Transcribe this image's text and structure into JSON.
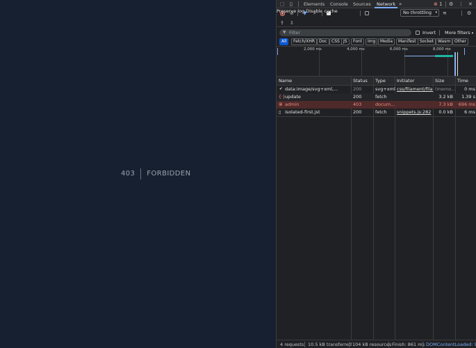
{
  "page": {
    "error_code": "403",
    "error_message": "FORBIDDEN"
  },
  "devtools": {
    "tabs": [
      "Elements",
      "Console",
      "Sources",
      "Network"
    ],
    "active_tab": "Network",
    "error_count": "1",
    "toolbar": {
      "preserve_log": "Preserve log",
      "disable_cache": "Disable cache",
      "throttling": "No throttling"
    },
    "filter": {
      "placeholder": "Filter",
      "invert": "Invert",
      "more_filters": "More filters"
    },
    "types": [
      "All",
      "Fetch/XHR",
      "Doc",
      "CSS",
      "JS",
      "Font",
      "Img",
      "Media",
      "Manifest",
      "Socket",
      "Wasm",
      "Other"
    ],
    "timeline": {
      "ticks": [
        "2,000 ms",
        "4,000 ms",
        "6,000 ms",
        "8,000 ms"
      ]
    },
    "table": {
      "headers": [
        "Name",
        "Status",
        "Type",
        "Initiator",
        "Size",
        "Time"
      ],
      "rows": [
        {
          "name": "data:image/svg+xml,...",
          "status": "200",
          "type": "svg+xml",
          "initiator": "css/filament/filam",
          "size": "(memo...",
          "time": "0 ms"
        },
        {
          "name": "update",
          "status": "200",
          "type": "fetch",
          "initiator": "",
          "size": "3.2 kB",
          "time": "1.39 s"
        },
        {
          "name": "admin",
          "status": "403",
          "type": "docum...",
          "initiator": "",
          "size": "7.3 kB",
          "time": "696 ms"
        },
        {
          "name": "isolated-first.jst",
          "status": "200",
          "type": "fetch",
          "initiator": "snippets.js:282",
          "size": "0.0 kB",
          "time": "6 ms"
        }
      ]
    },
    "status_bar": {
      "requests": "4 requests",
      "transferred": "10.5 kB transferred",
      "resources": "104 kB resources",
      "finish": "Finish: 861 ms",
      "dom_content_loaded": "DOMContentLoaded: 928"
    },
    "colors": {
      "accent": "#7cacf8",
      "error_row": "#4e2a2a",
      "error_text": "#f28b82"
    }
  }
}
